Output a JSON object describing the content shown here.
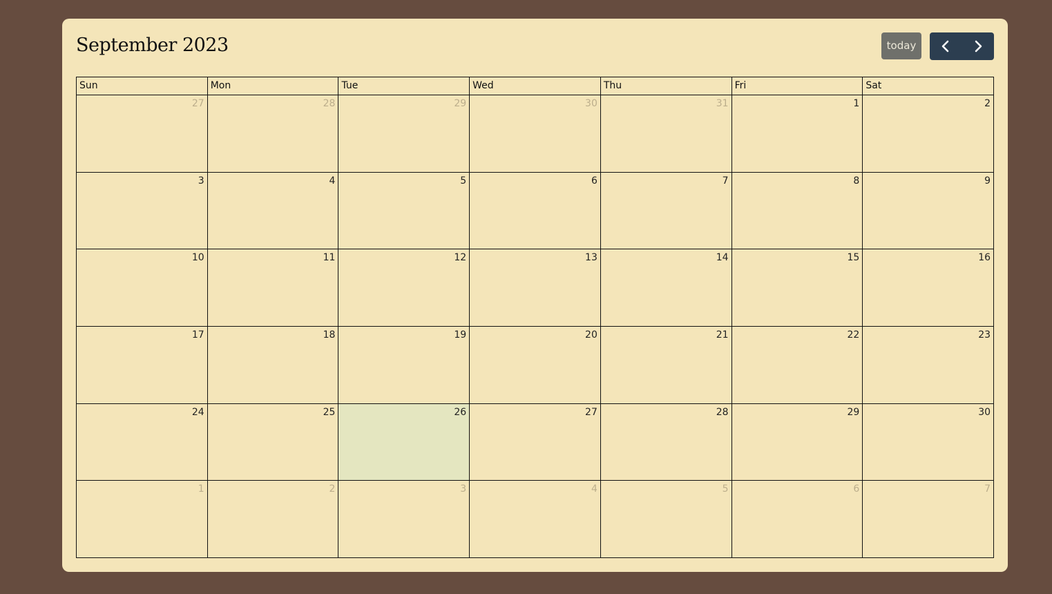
{
  "header": {
    "title": "September 2023",
    "today_label": "today",
    "prev_icon": "chevron-left-icon",
    "next_icon": "chevron-right-icon"
  },
  "colors": {
    "background": "#664c3f",
    "panel": "#f4e5b9",
    "today_button": "#6f706b",
    "nav_buttons": "#2c3e50",
    "today_highlight": "#e4e6c0",
    "other_month_text": "#bcae8c"
  },
  "weekdays": [
    "Sun",
    "Mon",
    "Tue",
    "Wed",
    "Thu",
    "Fri",
    "Sat"
  ],
  "weeks": [
    [
      {
        "d": "27",
        "o": true
      },
      {
        "d": "28",
        "o": true
      },
      {
        "d": "29",
        "o": true
      },
      {
        "d": "30",
        "o": true
      },
      {
        "d": "31",
        "o": true
      },
      {
        "d": "1"
      },
      {
        "d": "2"
      }
    ],
    [
      {
        "d": "3"
      },
      {
        "d": "4"
      },
      {
        "d": "5"
      },
      {
        "d": "6"
      },
      {
        "d": "7"
      },
      {
        "d": "8"
      },
      {
        "d": "9"
      }
    ],
    [
      {
        "d": "10"
      },
      {
        "d": "11"
      },
      {
        "d": "12"
      },
      {
        "d": "13"
      },
      {
        "d": "14"
      },
      {
        "d": "15"
      },
      {
        "d": "16"
      }
    ],
    [
      {
        "d": "17"
      },
      {
        "d": "18"
      },
      {
        "d": "19"
      },
      {
        "d": "20"
      },
      {
        "d": "21"
      },
      {
        "d": "22"
      },
      {
        "d": "23"
      }
    ],
    [
      {
        "d": "24"
      },
      {
        "d": "25"
      },
      {
        "d": "26",
        "t": true
      },
      {
        "d": "27"
      },
      {
        "d": "28"
      },
      {
        "d": "29"
      },
      {
        "d": "30"
      }
    ],
    [
      {
        "d": "1",
        "o": true
      },
      {
        "d": "2",
        "o": true
      },
      {
        "d": "3",
        "o": true
      },
      {
        "d": "4",
        "o": true
      },
      {
        "d": "5",
        "o": true
      },
      {
        "d": "6",
        "o": true
      },
      {
        "d": "7",
        "o": true
      }
    ]
  ]
}
